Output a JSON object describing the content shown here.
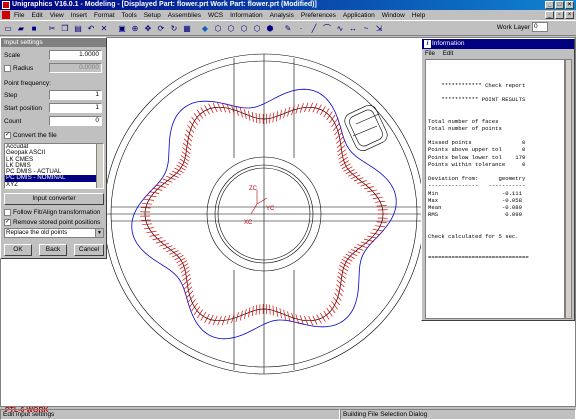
{
  "window": {
    "title": "Unigraphics V16.0.1 - Modeling - [Displayed Part: flower.prt   Work Part: flower.prt (Modified)]"
  },
  "menu": [
    "File",
    "Edit",
    "View",
    "Insert",
    "Format",
    "Tools",
    "Setup",
    "Assemblies",
    "WCS",
    "Information",
    "Analysis",
    "Preferences",
    "Application",
    "Window",
    "Help"
  ],
  "toolbar": {
    "work_layer_label": "Work Layer",
    "work_layer_value": "0"
  },
  "graphics": {
    "workview_label": "PTL-6 WORK",
    "triad": {
      "zc": "ZC",
      "yc": "YC",
      "xc": "XC"
    }
  },
  "dialog": {
    "title": "Input settings",
    "scale_label": "Scale",
    "scale_value": "1.0000",
    "radius_label": "Radius",
    "radius_value": "0.0000",
    "point_frequency_label": "Point frequency:",
    "step_label": "Step",
    "step_value": "1",
    "start_position_label": "Start position",
    "start_position_value": "1",
    "count_label": "Count",
    "count_value": "0",
    "convert_file_label": "Convert the file",
    "converter_list": [
      "Accudat",
      "Geopak ASCII",
      "LK CMES",
      "LK DMIS",
      "PC DMIS - ACTUAL",
      "PC DMIS - NOMINAL",
      "XYZ"
    ],
    "selected_converter": "PC DMIS - NOMINAL",
    "input_converter_button": "Input converter",
    "follow_fit_label": "Follow Fit/Align transformation",
    "remove_stored_label": "Remove stored point positions",
    "replace_option": "Replace the old points",
    "ok_button": "OK",
    "back_button": "Back",
    "cancel_button": "Cancel"
  },
  "information": {
    "title": "Information",
    "menu": [
      "File",
      "Edit"
    ],
    "lines": [
      "",
      "",
      "",
      "    ************ Check report",
      "",
      "    *********** POINT RESULTS",
      "",
      "",
      "Total number of faces",
      "Total number of points",
      "",
      "Missed points               0",
      "Points above upper tol      0",
      "Points below lower tol    179",
      "Points within tolerance     0",
      "",
      "Deviation from:      geometry",
      "---------------   -----------",
      "Min                   -0.111",
      "Max                   -0.058",
      "Mean                  -0.089",
      "RMS                    0.090",
      "",
      "",
      "Check calculated for 5 sec.",
      "",
      "",
      "=============================="
    ]
  },
  "status": {
    "left": "Edit input settings",
    "right": "Building File Selection Dialog"
  },
  "colors": {
    "title_active": "#000080",
    "deviation_marks": "#e00000",
    "tolerance_curve": "#0000cc",
    "workview_label": "#c00000"
  }
}
